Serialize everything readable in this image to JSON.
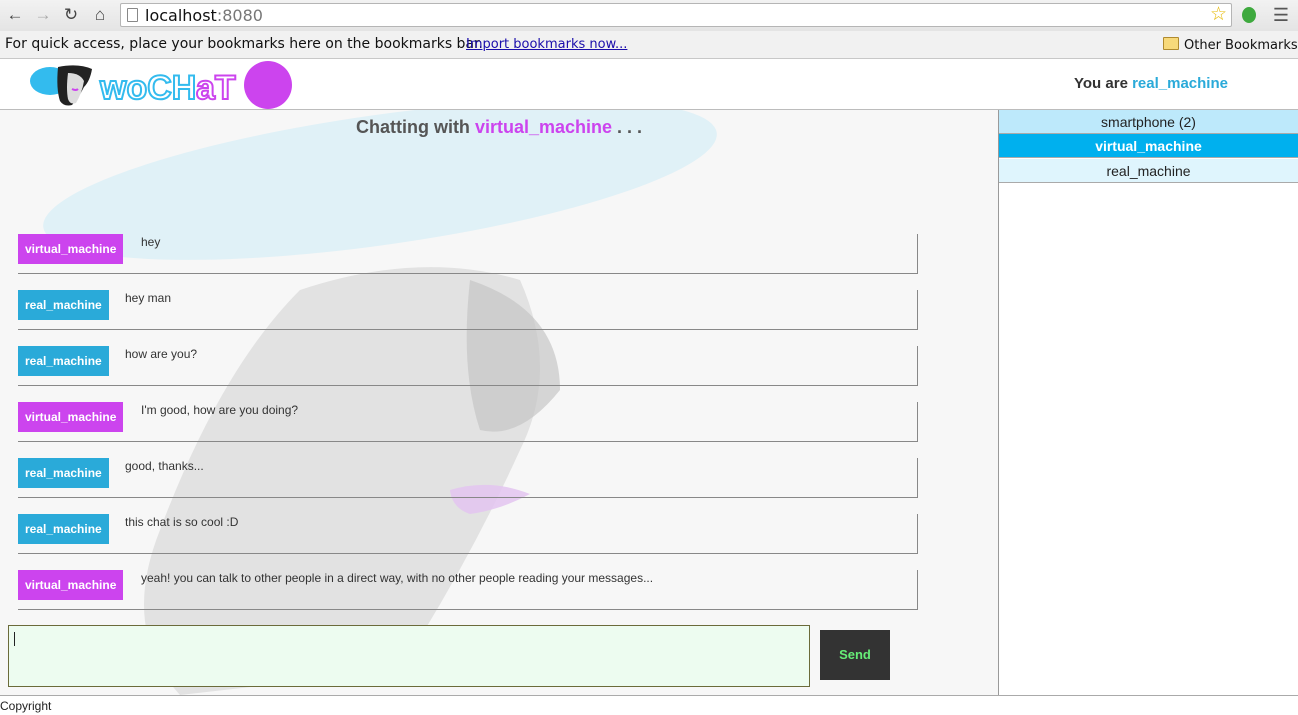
{
  "browser": {
    "url_host": "localhost",
    "url_port": ":8080",
    "bookmarks_prompt": "For quick access, place your bookmarks here on the bookmarks bar.",
    "import_link": "Import bookmarks now...",
    "other_bookmarks": "Other Bookmarks",
    "icons": [
      "back-icon",
      "forward-icon",
      "reload-icon",
      "home-icon",
      "page-icon",
      "star-icon",
      "extension-icon",
      "menu-icon",
      "folder-icon"
    ]
  },
  "header": {
    "logo_text": "woCHaT",
    "you_are_label": "You are",
    "current_user": "real_machine"
  },
  "chat": {
    "title_prefix": "Chatting with",
    "partner": "virtual_machine",
    "title_suffix": ". . .",
    "messages": [
      {
        "sender": "virtual_machine",
        "text": "hey"
      },
      {
        "sender": "real_machine",
        "text": "hey man"
      },
      {
        "sender": "real_machine",
        "text": "how are you?"
      },
      {
        "sender": "virtual_machine",
        "text": "I'm good, how are you doing?"
      },
      {
        "sender": "real_machine",
        "text": "good, thanks..."
      },
      {
        "sender": "real_machine",
        "text": "this chat is so cool :D"
      },
      {
        "sender": "virtual_machine",
        "text": "yeah! you can talk to other people in a direct way, with no other people reading your messages..."
      }
    ],
    "input_value": "",
    "send_label": "Send"
  },
  "users": {
    "items": [
      {
        "label": "smartphone (2)",
        "selected": false
      },
      {
        "label": "virtual_machine",
        "selected": true
      },
      {
        "label": "real_machine",
        "selected": false
      }
    ]
  },
  "footer": {
    "copyright": "Copyright"
  },
  "colors": {
    "accent_violet": "#cc44ee",
    "accent_blue": "#2aaad9",
    "selected_user": "#00b0ee",
    "user_item_bg_1": "#bde9fb",
    "user_item_bg_2": "#dff5fd",
    "send_text": "#66ee77"
  }
}
